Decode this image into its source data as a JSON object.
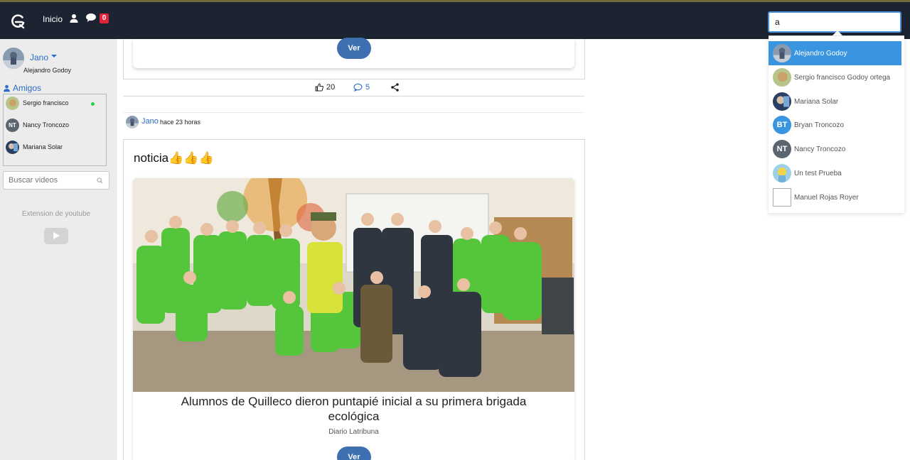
{
  "topbar": {
    "nav_home": "Inicio",
    "notifications_count": "0",
    "search_value": "a"
  },
  "sidebar": {
    "user_short": "Jano",
    "user_full": "Alejandro Godoy",
    "friends_title": "Amigos",
    "friends": [
      {
        "name": "Sergio francisco",
        "online": true
      },
      {
        "name": "Nancy Troncozo",
        "initials": "NT",
        "online": false
      },
      {
        "name": "Mariana Solar",
        "online": false
      }
    ],
    "video_search_placeholder": "Buscar videos",
    "youtube_label": "Extension de youtube"
  },
  "feed": {
    "prev_post": {
      "button_label": "Ver",
      "likes": "20",
      "comments": "5"
    },
    "post": {
      "author": "Jano",
      "time": "hace 23 horas",
      "text": "noticia👍👍👍",
      "link": {
        "title": "Alumnos de Quilleco dieron puntapié inicial a su primera brigada ecológica",
        "source": "Diario Latribuna",
        "button_label": "Ver"
      }
    }
  },
  "search_results": [
    {
      "name": "Alejandro Godoy",
      "active": true
    },
    {
      "name": "Sergio francisco Godoy ortega"
    },
    {
      "name": "Mariana Solar"
    },
    {
      "name": "Bryan Troncozo",
      "initials": "BT",
      "color": "#3a95e0"
    },
    {
      "name": "Nancy Troncozo",
      "initials": "NT",
      "color": "#5a6570"
    },
    {
      "name": "Un test Prueba"
    },
    {
      "name": "Manuel Rojas Royer",
      "broken_image": true
    }
  ]
}
